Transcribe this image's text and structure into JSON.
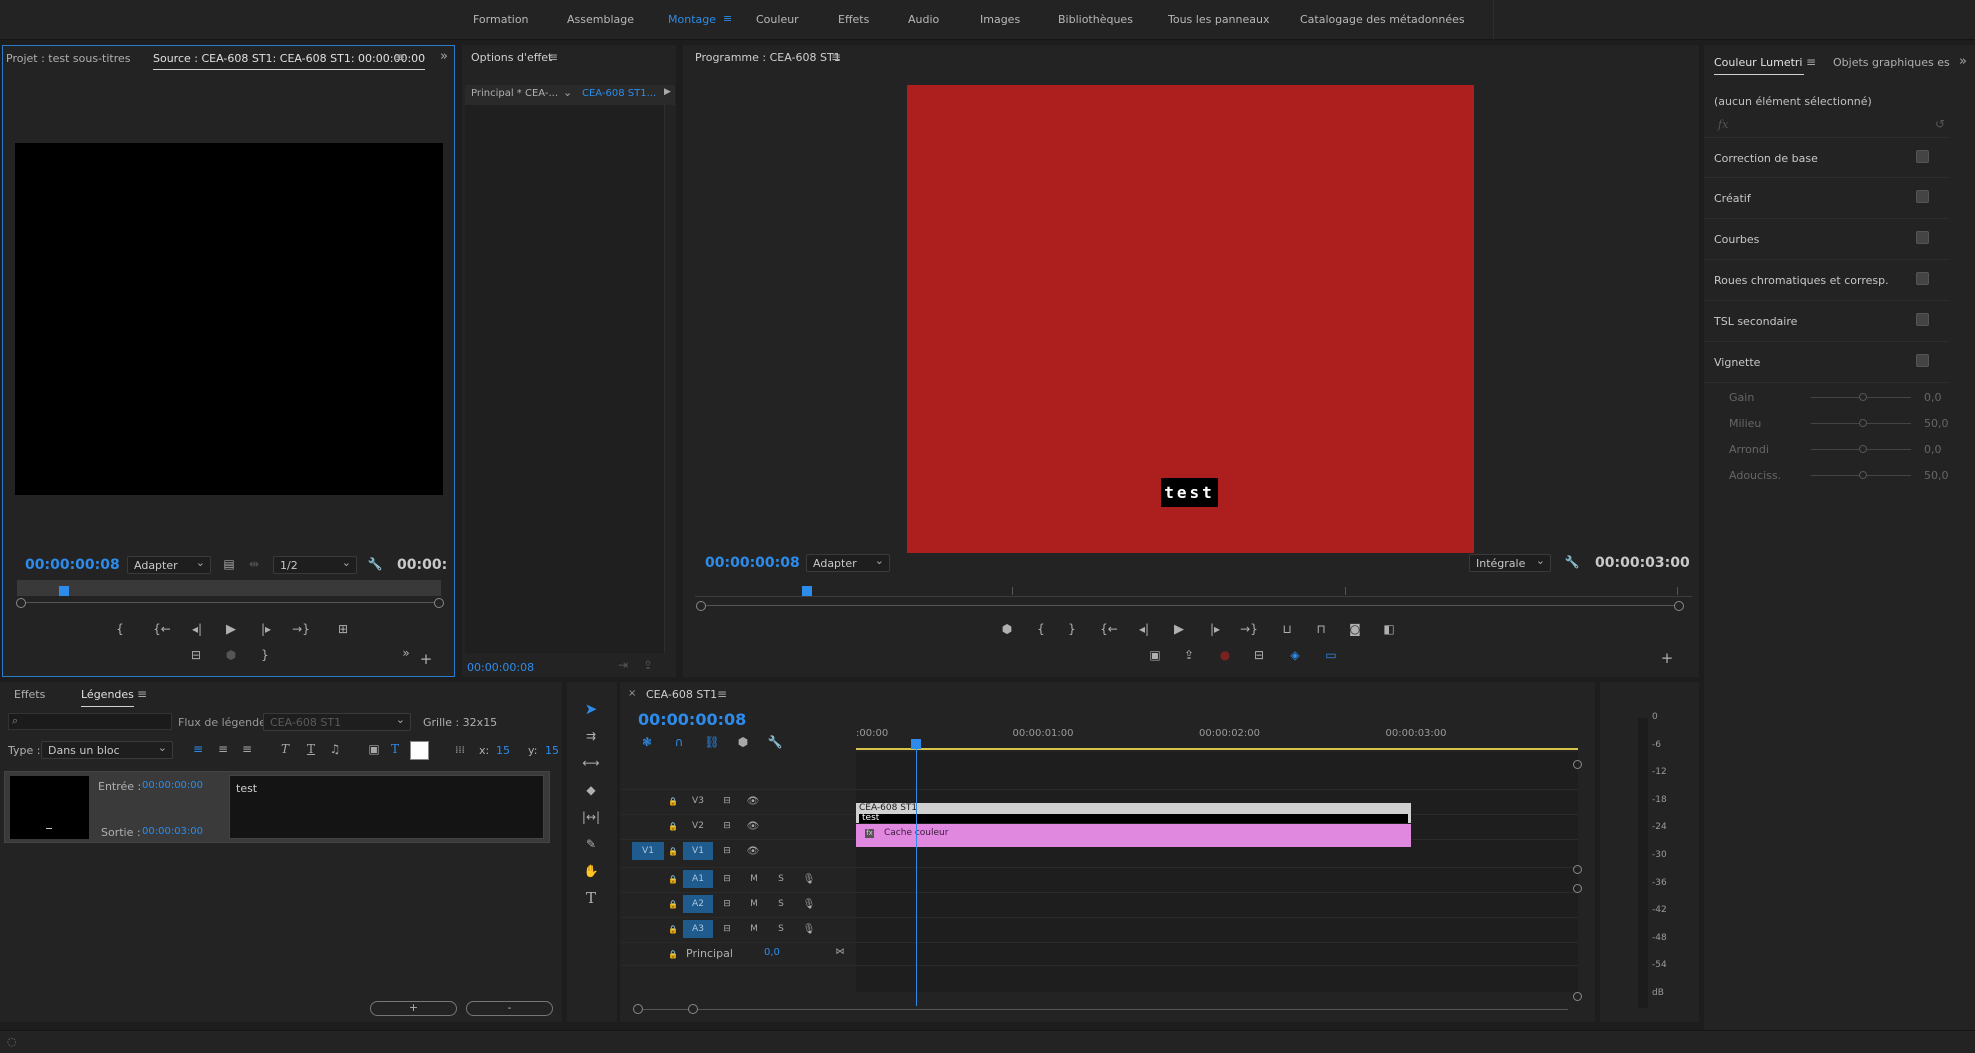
{
  "menu": [
    "Formation",
    "Assemblage",
    "Montage",
    "Couleur",
    "Effets",
    "Audio",
    "Images",
    "Bibliothèques",
    "Tous les panneaux",
    "Catalogage des métadonnées"
  ],
  "menu_active_index": 2,
  "source": {
    "tab_project": "Projet : test sous-titres",
    "tab_source": "Source : CEA-608 ST1: CEA-608 ST1: 00:00:00:00",
    "timecode": "00:00:00:08",
    "fit": "Adapter",
    "resolution": "1/2",
    "duration": "00:00:",
    "playhead_fraction": 0.1
  },
  "effect_options": {
    "title": "Options d'effet",
    "tab_master": "Principal * CEA-...",
    "tab_clip": "CEA-608 ST1...",
    "timecode": "00:00:00:08"
  },
  "program": {
    "title": "Programme : CEA-608 ST1",
    "timecode": "00:00:00:08",
    "fit": "Adapter",
    "quality": "Intégrale",
    "duration": "00:00:03:00",
    "caption_text": "test",
    "frame_color": "#ad1f1f",
    "playhead_fraction": 0.107
  },
  "lumetri": {
    "tab_lumetri": "Couleur Lumetri",
    "tab_graphics": "Objets graphiques es",
    "selection": "(aucun élément sélectionné)",
    "fx": "fx",
    "sections": [
      "Correction de base",
      "Créatif",
      "Courbes",
      "Roues chromatiques et corresp.",
      "TSL secondaire",
      "Vignette"
    ],
    "vignette": [
      {
        "label": "Gain",
        "value": "0,0"
      },
      {
        "label": "Milieu",
        "value": "50,0"
      },
      {
        "label": "Arrondi",
        "value": "0,0"
      },
      {
        "label": "Adouciss.",
        "value": "50,0"
      }
    ]
  },
  "captions": {
    "tab_effects": "Effets",
    "tab_captions": "Légendes",
    "stream_label": "Flux de légende :",
    "stream_value": "CEA-608 ST1",
    "grid": "Grille : 32x15",
    "type_label": "Type :",
    "type_value": "Dans un bloc",
    "x_label": "x:",
    "x_value": "15",
    "y_label": "y:",
    "y_value": "15",
    "in_label": "Entrée :",
    "in_value": "00:00:00:00",
    "out_label": "Sortie :",
    "out_value": "00:00:03:00",
    "text": "test",
    "add": "+",
    "remove": "-"
  },
  "timeline": {
    "title": "CEA-608 ST1",
    "timecode": "00:00:00:08",
    "ruler": [
      ":00:00",
      "00:00:01:00",
      "00:00:02:00",
      "00:00:03:00"
    ],
    "video_tracks": [
      "V3",
      "V2",
      "V1"
    ],
    "audio_tracks": [
      "A1",
      "A2",
      "A3"
    ],
    "source_patch": "V1",
    "master_label": "Principal",
    "master_value": "0,0",
    "mute": "M",
    "solo": "S",
    "caption_clip_name": "CEA-608 ST1",
    "caption_clip_text": "test",
    "matte_clip_name": "Cache couleur",
    "matte_color": "#e087e0",
    "playhead_seconds": 0.32
  },
  "meter": {
    "scale": [
      "0",
      "-6",
      "-12",
      "-18",
      "-24",
      "-30",
      "-36",
      "-42",
      "-48",
      "-54",
      "dB"
    ]
  }
}
